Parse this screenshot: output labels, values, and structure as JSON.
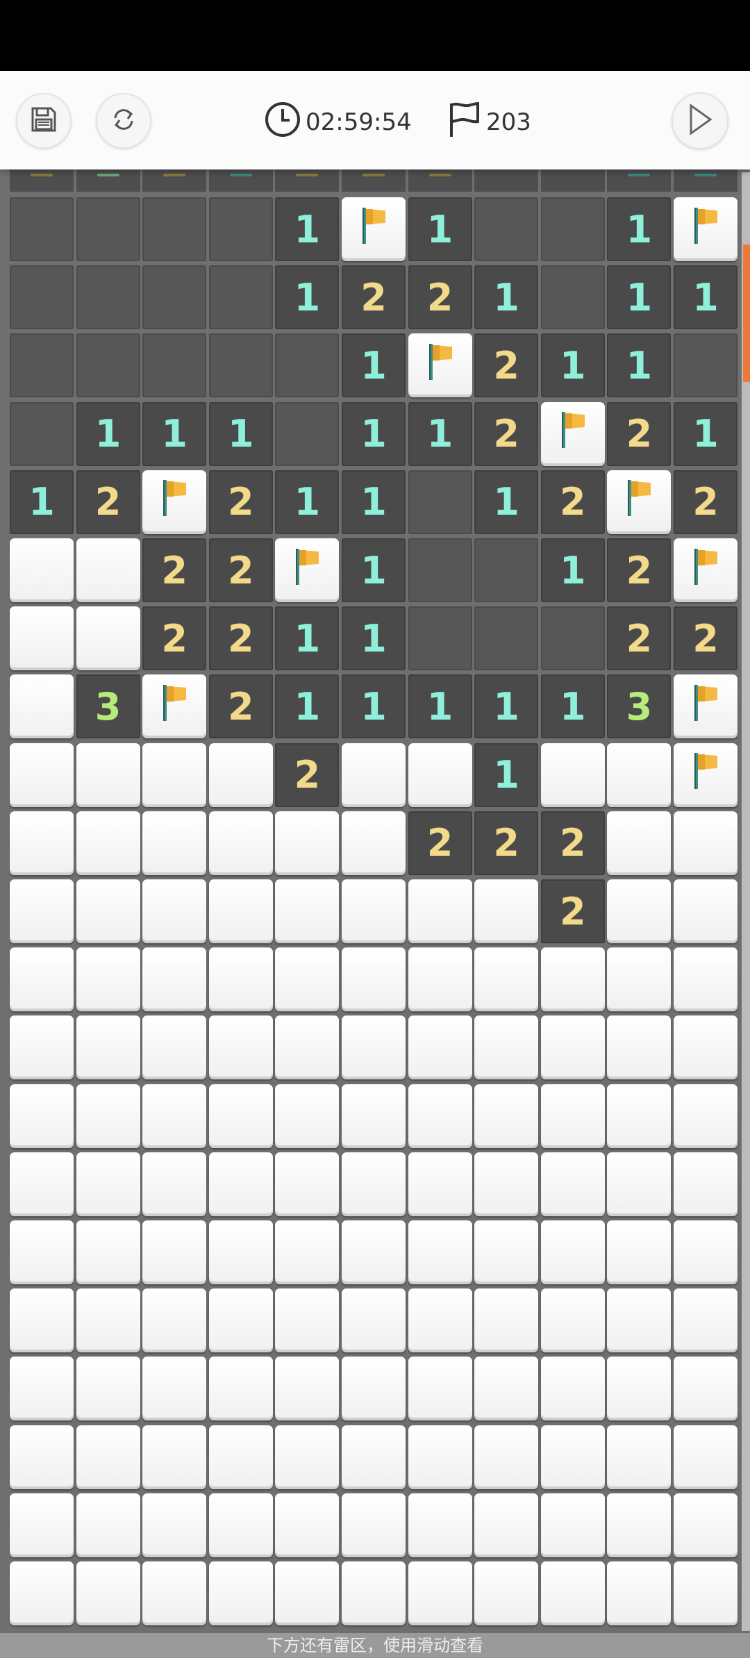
{
  "toolbar": {
    "save_icon": "save-disk-icon",
    "refresh_icon": "refresh-icon",
    "timer_icon": "clock-icon",
    "timer": "02:59:54",
    "flag_icon": "flag-outline-icon",
    "flag_count": "203",
    "play_icon": "play-triangle-icon"
  },
  "colors": {
    "number_1": "#8ef0da",
    "number_2": "#f3d98a",
    "number_3": "#b8ec7a",
    "flag": "#f5b942",
    "scroll_thumb": "#ee7a3a"
  },
  "legend": {
    "C": "covered",
    "F": "flagged",
    "D": "unrevealed-dark",
    "R": "revealed-empty",
    "1": "number 1",
    "2": "number 2",
    "3": "number 3"
  },
  "board": {
    "columns": 11,
    "rows": [
      [
        "D",
        "D",
        "D",
        "D",
        "1",
        "F",
        "1",
        "D",
        "D",
        "1",
        "F"
      ],
      [
        "D",
        "D",
        "D",
        "D",
        "1",
        "2",
        "2",
        "1",
        "D",
        "1",
        "1"
      ],
      [
        "D",
        "D",
        "D",
        "D",
        "D",
        "1",
        "F",
        "2",
        "1",
        "1",
        "D"
      ],
      [
        "D",
        "1",
        "1",
        "1",
        "D",
        "1",
        "1",
        "2",
        "F",
        "2",
        "1"
      ],
      [
        "1",
        "2",
        "F",
        "2",
        "1",
        "1",
        "D",
        "1",
        "2",
        "F",
        "2"
      ],
      [
        "C",
        "C",
        "2",
        "2",
        "F",
        "1",
        "D",
        "D",
        "1",
        "2",
        "F"
      ],
      [
        "C",
        "C",
        "2",
        "2",
        "1",
        "1",
        "D",
        "D",
        "D",
        "2",
        "2"
      ],
      [
        "C",
        "3",
        "F",
        "2",
        "1",
        "1",
        "1",
        "1",
        "1",
        "3",
        "F"
      ],
      [
        "C",
        "C",
        "C",
        "C",
        "2",
        "C",
        "C",
        "1",
        "C",
        "C",
        "F"
      ],
      [
        "C",
        "C",
        "C",
        "C",
        "C",
        "C",
        "2",
        "2",
        "2",
        "C",
        "C"
      ],
      [
        "C",
        "C",
        "C",
        "C",
        "C",
        "C",
        "C",
        "C",
        "2",
        "C",
        "C"
      ],
      [
        "C",
        "C",
        "C",
        "C",
        "C",
        "C",
        "C",
        "C",
        "C",
        "C",
        "C"
      ],
      [
        "C",
        "C",
        "C",
        "C",
        "C",
        "C",
        "C",
        "C",
        "C",
        "C",
        "C"
      ],
      [
        "C",
        "C",
        "C",
        "C",
        "C",
        "C",
        "C",
        "C",
        "C",
        "C",
        "C"
      ],
      [
        "C",
        "C",
        "C",
        "C",
        "C",
        "C",
        "C",
        "C",
        "C",
        "C",
        "C"
      ],
      [
        "C",
        "C",
        "C",
        "C",
        "C",
        "C",
        "C",
        "C",
        "C",
        "C",
        "C"
      ],
      [
        "C",
        "C",
        "C",
        "C",
        "C",
        "C",
        "C",
        "C",
        "C",
        "C",
        "C"
      ],
      [
        "C",
        "C",
        "C",
        "C",
        "C",
        "C",
        "C",
        "C",
        "C",
        "C",
        "C"
      ],
      [
        "C",
        "C",
        "C",
        "C",
        "C",
        "C",
        "C",
        "C",
        "C",
        "C",
        "C"
      ],
      [
        "C",
        "C",
        "C",
        "C",
        "C",
        "C",
        "C",
        "C",
        "C",
        "C",
        "C"
      ],
      [
        "C",
        "C",
        "C",
        "C",
        "C",
        "C",
        "C",
        "C",
        "C",
        "C",
        "C"
      ]
    ]
  },
  "footer": {
    "hint": "下方还有雷区，使用滑动查看"
  }
}
